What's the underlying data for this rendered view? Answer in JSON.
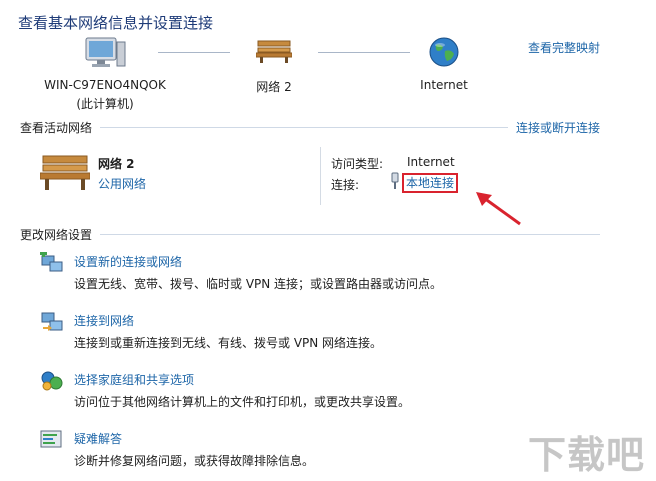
{
  "header": {
    "title": "查看基本网络信息并设置连接",
    "view_full_map": "查看完整映射"
  },
  "network_map": {
    "computer": {
      "name": "WIN-C97ENO4NQOK",
      "subtitle": "(此计算机)",
      "icon": "computer-icon"
    },
    "network": {
      "name": "网络  2",
      "icon": "bench-icon"
    },
    "internet": {
      "name": "Internet",
      "icon": "globe-icon"
    }
  },
  "active_networks": {
    "heading": "查看活动网络",
    "connect_disconnect": "连接或断开连接",
    "network_name": "网络  2",
    "network_type": "公用网络",
    "access_type_label": "访问类型:",
    "access_type_value": "Internet",
    "connection_label": "连接:",
    "connection_value": "本地连接"
  },
  "settings": {
    "heading": "更改网络设置",
    "tasks": [
      {
        "title": "设置新的连接或网络",
        "desc": "设置无线、宽带、拨号、临时或 VPN 连接；或设置路由器或访问点。",
        "icon": "new-connection-icon"
      },
      {
        "title": "连接到网络",
        "desc": "连接到或重新连接到无线、有线、拨号或 VPN 网络连接。",
        "icon": "connect-network-icon"
      },
      {
        "title": "选择家庭组和共享选项",
        "desc": "访问位于其他网络计算机上的文件和打印机，或更改共享设置。",
        "icon": "homegroup-icon"
      },
      {
        "title": "疑难解答",
        "desc": "诊断并修复网络问题，或获得故障排除信息。",
        "icon": "troubleshoot-icon"
      }
    ]
  },
  "watermark": "下载吧",
  "colors": {
    "link": "#1e66a8",
    "title": "#1e3b78",
    "highlight": "#d9232e"
  }
}
